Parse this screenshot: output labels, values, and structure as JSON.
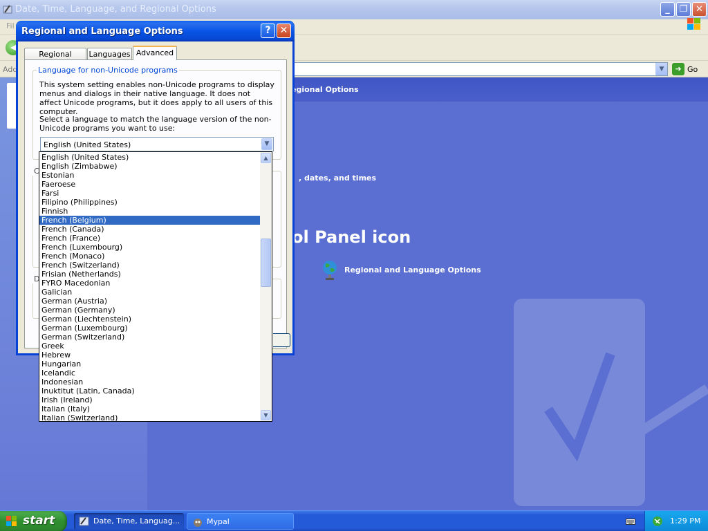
{
  "background_window": {
    "title": "Date, Time, Language, and Regional Options",
    "menu_first_letter": "Fil",
    "address_label": "Add",
    "go_label": "Go",
    "content_header": "egional Options",
    "task_text": ", dates, and times",
    "big_title": "ol Panel icon",
    "cp_link_label": "Regional and Language Options"
  },
  "dialog": {
    "title": "Regional and Language Options",
    "help_label": "?",
    "close_label": "✕",
    "tabs": [
      {
        "label": "Regional Options"
      },
      {
        "label": "Languages"
      },
      {
        "label": "Advanced"
      }
    ],
    "group_non_unicode": {
      "legend": "Language for non-Unicode programs",
      "description": "This system setting enables non-Unicode programs to display menus and dialogs in their native language. It does not affect Unicode programs, but it does apply to all users of this computer.",
      "instruction": "Select a language to match the language version of the non-Unicode programs you want to use:"
    },
    "group2_stub": "C",
    "group3_stub": "D",
    "combo_value": "English (United States)"
  },
  "dropdown_items": [
    "English (United States)",
    "English (Zimbabwe)",
    "Estonian",
    "Faeroese",
    "Farsi",
    "Filipino (Philippines)",
    "Finnish",
    "French (Belgium)",
    "French (Canada)",
    "French (France)",
    "French (Luxembourg)",
    "French (Monaco)",
    "French (Switzerland)",
    "Frisian (Netherlands)",
    "FYRO Macedonian",
    "Galician",
    "German (Austria)",
    "German (Germany)",
    "German (Liechtenstein)",
    "German (Luxembourg)",
    "German (Switzerland)",
    "Greek",
    "Hebrew",
    "Hungarian",
    "Icelandic",
    "Indonesian",
    "Inuktitut (Latin, Canada)",
    "Irish (Ireland)",
    "Italian (Italy)",
    "Italian (Switzerland)"
  ],
  "dropdown_selected": "French (Belgium)",
  "taskbar": {
    "start_label": "start",
    "items": [
      {
        "label": "Date, Time, Languag..."
      },
      {
        "label": "Mypal"
      }
    ],
    "clock": "1:29 PM"
  },
  "colors": {
    "selection": "#316ac5",
    "desktop_content": "#5a6fd1",
    "title_blue": "#0955e6"
  }
}
